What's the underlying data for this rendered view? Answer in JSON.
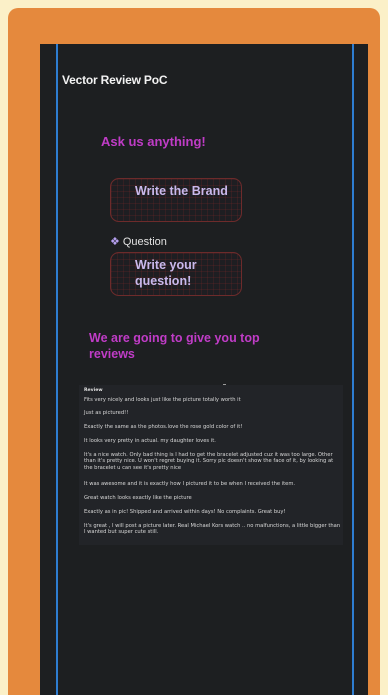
{
  "app": {
    "title": "Vector Review PoC"
  },
  "ask": {
    "heading": "Ask us anything!"
  },
  "brand_box": {
    "text": "Write the Brand"
  },
  "question": {
    "label": "Question",
    "icon": "diamond-icon",
    "box_text": "Write your question!"
  },
  "give": {
    "heading": "We are going to give you top reviews"
  },
  "reviews": {
    "header": "Review",
    "items": [
      "Fits very nicely and looks just like the picture totally worth it",
      "Just as pictured!!",
      "Exactly the same as the photos.love the rose gold color of it!",
      "It looks very pretty in actual. my daughter loves it.",
      "It's a nice watch. Only bad thing is I had to get the bracelet adjusted cuz it was too large. Other than it's pretty nice. U won't regret buying it. Sorry pic doesn't show the face of it, by looking at the bracelet u can see it's pretty nice",
      "It was awesome and it is exactly how I pictured it to be when I received the item.",
      "Great watch looks exactly like the picture",
      "Exactly as in pic! Shipped and arrived within days! No complaints. Great buy!",
      "It's great , I will post a picture later. Real Michael Kors watch .. no malfunctions, a little bigger than I wanted but super cute still."
    ]
  },
  "colors": {
    "frame": "#e5893d",
    "screen": "#1d1f21",
    "accent": "#c03cc7",
    "guide": "#2e7dd1"
  }
}
